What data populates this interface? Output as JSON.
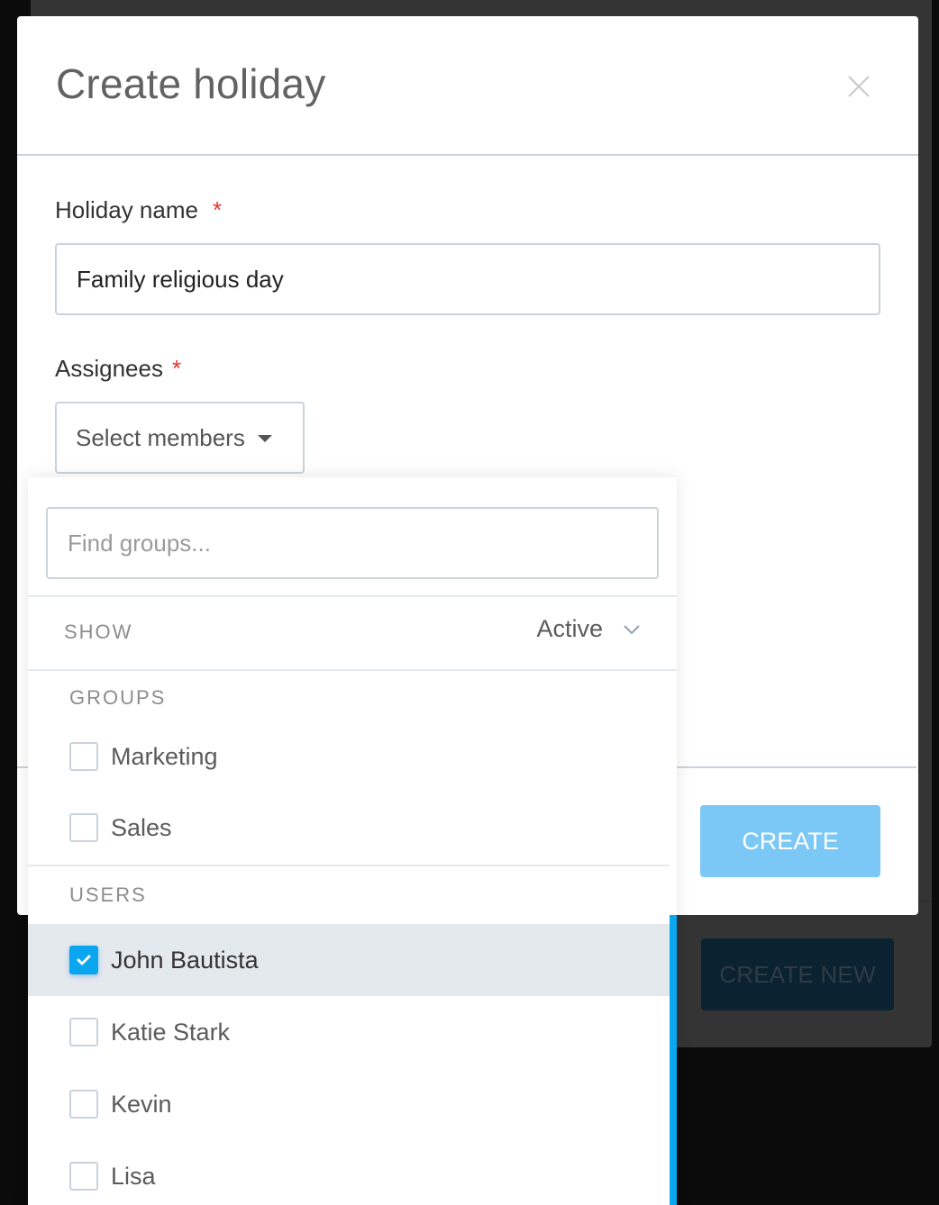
{
  "background": {
    "create_new_label": "CREATE NEW"
  },
  "modal": {
    "title": "Create holiday",
    "close_icon": "close-icon",
    "holiday_name": {
      "label": "Holiday name",
      "required_mark": "*",
      "value": "Family religious day"
    },
    "assignees": {
      "label": "Assignees",
      "required_mark": "*",
      "select_label": "Select members"
    },
    "create_label": "CREATE"
  },
  "dropdown": {
    "search_placeholder": "Find groups...",
    "search_value": "",
    "show": {
      "label": "SHOW",
      "value": "Active"
    },
    "groups": {
      "label": "GROUPS",
      "items": [
        {
          "name": "Marketing",
          "checked": false
        },
        {
          "name": "Sales",
          "checked": false
        }
      ]
    },
    "users": {
      "label": "USERS",
      "items": [
        {
          "name": "John Bautista",
          "checked": true
        },
        {
          "name": "Katie Stark",
          "checked": false
        },
        {
          "name": "Kevin",
          "checked": false
        },
        {
          "name": "Lisa",
          "checked": false
        }
      ]
    }
  },
  "colors": {
    "accent": "#0aa6ef",
    "create_button": "#7bc7f6",
    "required": "#e8342f",
    "selected_row": "#e4e9ee"
  }
}
